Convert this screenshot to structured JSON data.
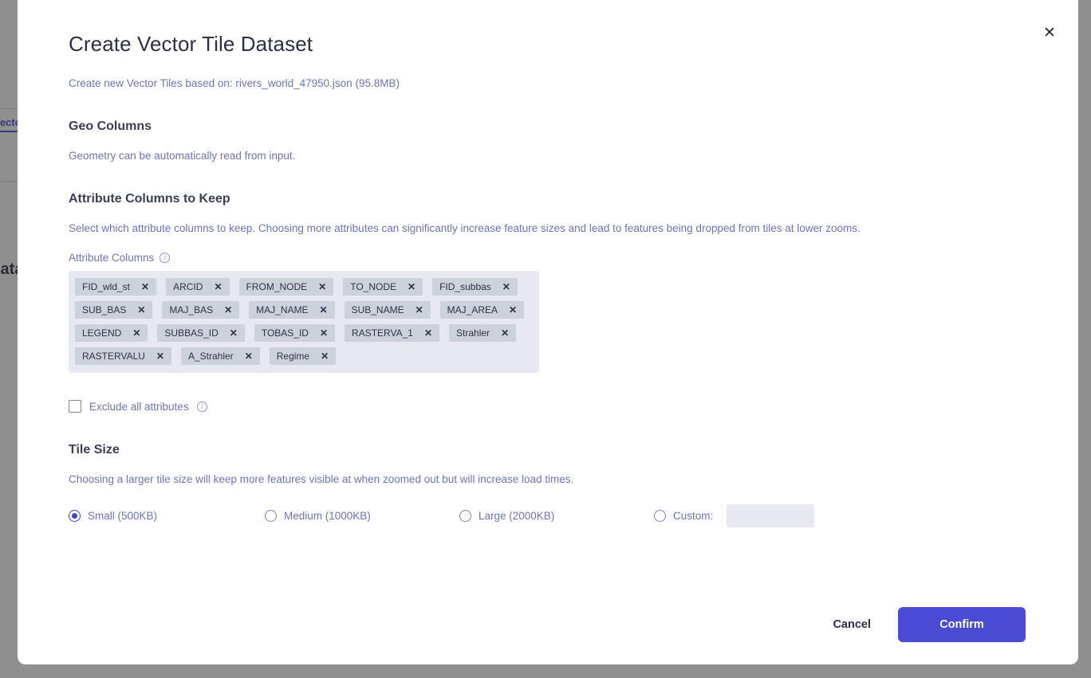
{
  "background": {
    "tab_label": "Vector Tiles",
    "heading_text": "Datasets"
  },
  "modal": {
    "title": "Create Vector Tile Dataset",
    "subtitle": "Create new Vector Tiles based on: rivers_world_47950.json (95.8MB)",
    "close_label": "✕",
    "geo_columns": {
      "heading": "Geo Columns",
      "description": "Geometry can be automatically read from input."
    },
    "attribute_columns": {
      "heading": "Attribute Columns to Keep",
      "description": "Select which attribute columns to keep. Choosing more attributes can significantly increase feature sizes and lead to features being dropped from tiles at lower zooms.",
      "field_label": "Attribute Columns",
      "info_icon": "info-icon",
      "remove_glyph": "✕",
      "chips": [
        "FID_wld_st",
        "ARCID",
        "FROM_NODE",
        "TO_NODE",
        "FID_subbas",
        "SUB_BAS",
        "MAJ_BAS",
        "MAJ_NAME",
        "SUB_NAME",
        "MAJ_AREA",
        "LEGEND",
        "SUBBAS_ID",
        "TOBAS_ID",
        "RASTERVA_1",
        "Strahler",
        "RASTERVALU",
        "A_Strahler",
        "Regime"
      ],
      "exclude_all_label": "Exclude all attributes",
      "exclude_all_checked": false
    },
    "tile_size": {
      "heading": "Tile Size",
      "description": "Choosing a larger tile size will keep more features visible at when zoomed out but will increase load times.",
      "options": [
        {
          "label": "Small (500KB)",
          "selected": true
        },
        {
          "label": "Medium (1000KB)",
          "selected": false
        },
        {
          "label": "Large (2000KB)",
          "selected": false
        },
        {
          "label": "Custom:",
          "selected": false
        }
      ],
      "custom_value": "",
      "custom_placeholder": ""
    },
    "footer": {
      "cancel_label": "Cancel",
      "confirm_label": "Confirm"
    }
  },
  "colors": {
    "accent": "#4a4ad4",
    "muted_text": "#6d74b8",
    "chip_bg": "#ccd1dc",
    "chip_container_bg": "#e7e8f1",
    "overlay": "#333333"
  }
}
